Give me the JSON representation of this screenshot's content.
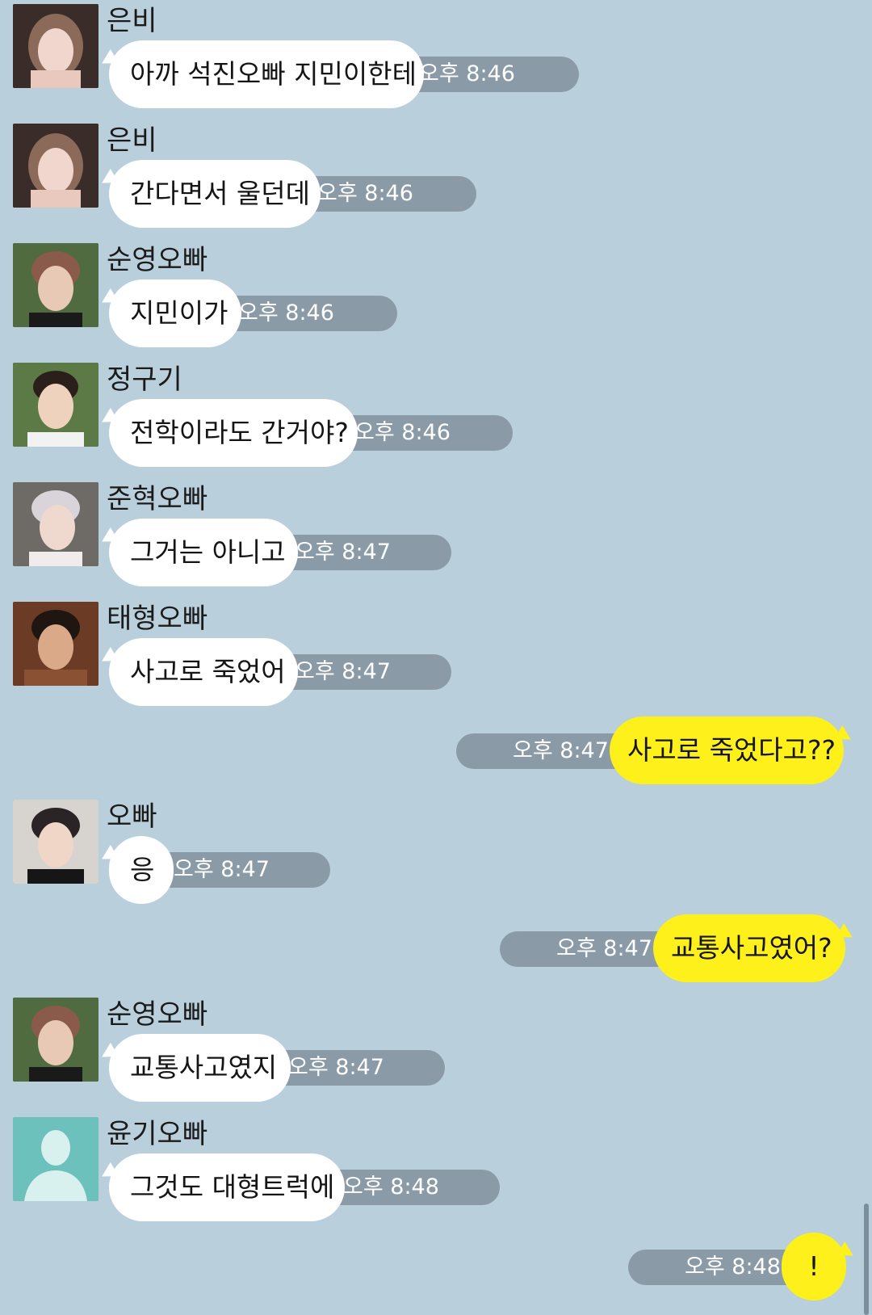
{
  "colors": {
    "background": "#bacfdc",
    "received_bubble": "#ffffff",
    "sent_bubble": "#fef01b",
    "time_pill": "#8a9ba7"
  },
  "messages": [
    {
      "sender": "은비",
      "text": "아까 석진오빠 지민이한테",
      "time": "오후 8:46",
      "avatar": "photo-girl-icon"
    },
    {
      "sender": "은비",
      "text": "간다면서 울던데",
      "time": "오후 8:46",
      "avatar": "photo-girl-icon"
    },
    {
      "sender": "순영오빠",
      "text": "지민이가",
      "time": "오후 8:46",
      "avatar": "photo-boy-icon"
    },
    {
      "sender": "정구기",
      "text": "전학이라도 간거야?",
      "time": "오후 8:46",
      "avatar": "photo-boy-icon"
    },
    {
      "sender": "준혁오빠",
      "text": "그거는 아니고",
      "time": "오후 8:47",
      "avatar": "photo-boy-icon"
    },
    {
      "sender": "태형오빠",
      "text": "사고로 죽었어",
      "time": "오후 8:47",
      "avatar": "photo-boy-icon"
    },
    {
      "sender": "",
      "text": "사고로 죽었다고??",
      "time": "오후 8:47",
      "mine": true
    },
    {
      "sender": "오빠",
      "text": "응",
      "time": "오후 8:47",
      "avatar": "photo-boy-icon"
    },
    {
      "sender": "",
      "text": "교통사고였어?",
      "time": "오후 8:47",
      "mine": true
    },
    {
      "sender": "순영오빠",
      "text": "교통사고였지",
      "time": "오후 8:47",
      "avatar": "photo-boy-icon"
    },
    {
      "sender": "윤기오빠",
      "text": "그것도 대형트럭에",
      "time": "오후 8:48",
      "avatar": "default-profile-icon"
    },
    {
      "sender": "",
      "text": "!",
      "time": "오후 8:48",
      "mine": true
    }
  ]
}
